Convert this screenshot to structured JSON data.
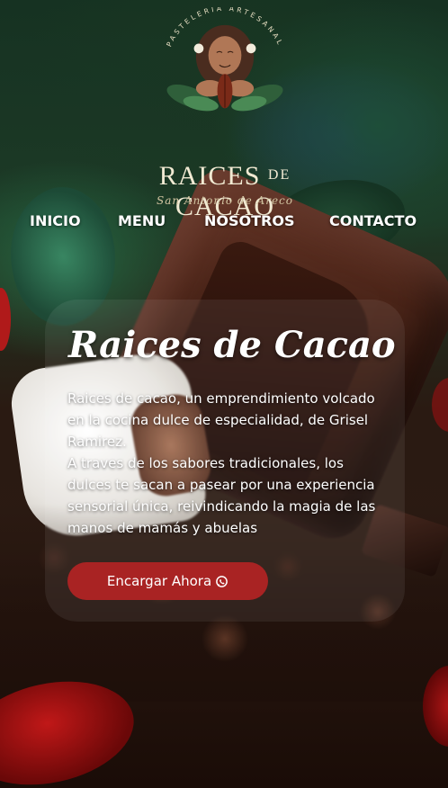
{
  "brand": {
    "arc_text": "PASTELERÍA ARTESANAL",
    "name_left": "RAICES",
    "name_mid": "DE",
    "name_right": "CACAO",
    "location": "San Antonio de Areco"
  },
  "nav": {
    "items": [
      {
        "label": "INICIO"
      },
      {
        "label": "MENU"
      },
      {
        "label": "NOSOTROS"
      },
      {
        "label": "CONTACTO"
      }
    ]
  },
  "hero": {
    "title": "Raices de Cacao",
    "paragraph1": "Raices de cacao, un emprendimiento volcado en la cocina dulce de especialidad, de Grisel Ramirez.",
    "paragraph2": "A traves de los sabores tradicionales, los dulces te sacan a pasear por una experiencia sensorial única, reivindicando la magia de las manos de mamás y abuelas",
    "cta_label": "Encargar Ahora",
    "cta_icon": "whatsapp-icon",
    "cta_color": "#a92323"
  },
  "colors": {
    "brand_cream": "#f1ead3",
    "button_red": "#a92323",
    "text": "#ffffff"
  }
}
